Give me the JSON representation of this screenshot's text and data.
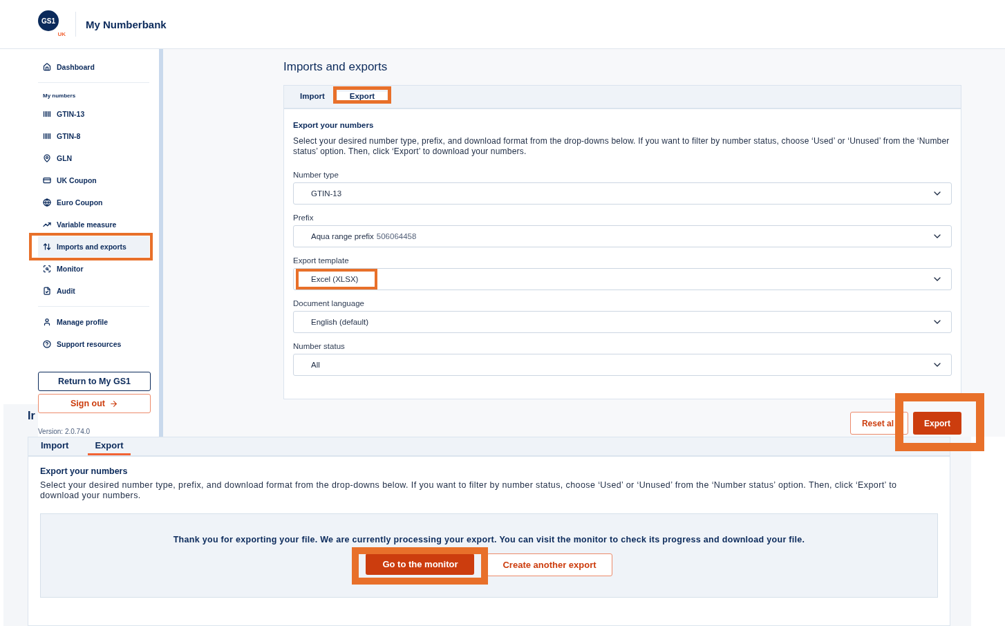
{
  "header": {
    "logo_text": "GS1",
    "logo_sub": "UK",
    "title": "My Numberbank"
  },
  "sidebar": {
    "groups": [
      {
        "items": [
          {
            "label": "Dashboard",
            "selected": false
          }
        ]
      },
      {
        "heading": "My numbers",
        "items": [
          {
            "label": "GTIN-13",
            "selected": false
          },
          {
            "label": "GTIN-8",
            "selected": false
          },
          {
            "label": "GLN",
            "selected": false
          },
          {
            "label": "UK Coupon",
            "selected": false
          },
          {
            "label": "Euro Coupon",
            "selected": false
          },
          {
            "label": "Variable measure",
            "selected": false
          },
          {
            "label": "Imports and exports",
            "selected": true,
            "highlighted": true
          },
          {
            "label": "Monitor",
            "selected": false
          },
          {
            "label": "Audit",
            "selected": false
          }
        ]
      },
      {
        "items": [
          {
            "label": "Manage profile",
            "selected": false
          },
          {
            "label": "Support resources",
            "selected": false
          }
        ]
      }
    ],
    "return_button": "Return to My GS1",
    "sign_out_button": "Sign out",
    "version": "Version: 2.0.74.0"
  },
  "main": {
    "title": "Imports and exports",
    "tabs": [
      {
        "label": "Import",
        "selected": false
      },
      {
        "label": "Export",
        "selected": true,
        "highlighted": true
      }
    ],
    "section_title": "Export your numbers",
    "description": "Select your desired number type, prefix, and download format from the drop-downs below. If you want to filter by number status, choose ‘Used’ or ‘Unused’ from the ‘Number status’ option. Then, click ‘Export’ to download your numbers.",
    "fields": [
      {
        "label": "Number type",
        "value": "GTIN-13"
      },
      {
        "label": "Prefix",
        "value": "Aqua range prefix",
        "value_secondary": "506064458"
      },
      {
        "label": "Export template",
        "value": "Excel (XLSX)",
        "highlighted": true
      },
      {
        "label": "Document language",
        "value": "English (default)"
      },
      {
        "label": "Number status",
        "value": "All"
      }
    ],
    "reset_button": "Reset al",
    "export_button": {
      "label": "Export",
      "highlighted": true
    }
  },
  "second_view": {
    "heading": "Ir",
    "tabs": [
      {
        "label": "Import",
        "selected": false
      },
      {
        "label": "Export",
        "selected": true
      }
    ],
    "section_title": "Export your numbers",
    "description": "Select your desired number type, prefix, and download format from the drop-downs below. If you want to filter by number status, choose ‘Used’ or ‘Unused’ from the ‘Number status’ option. Then, click ‘Export’ to download your numbers.",
    "notice": "Thank you for exporting your file. We are currently processing your export. You can visit the monitor to check its progress and download your file.",
    "monitor_button": {
      "label": "Go to the monitor",
      "highlighted": true
    },
    "another_button": "Create another export"
  }
}
